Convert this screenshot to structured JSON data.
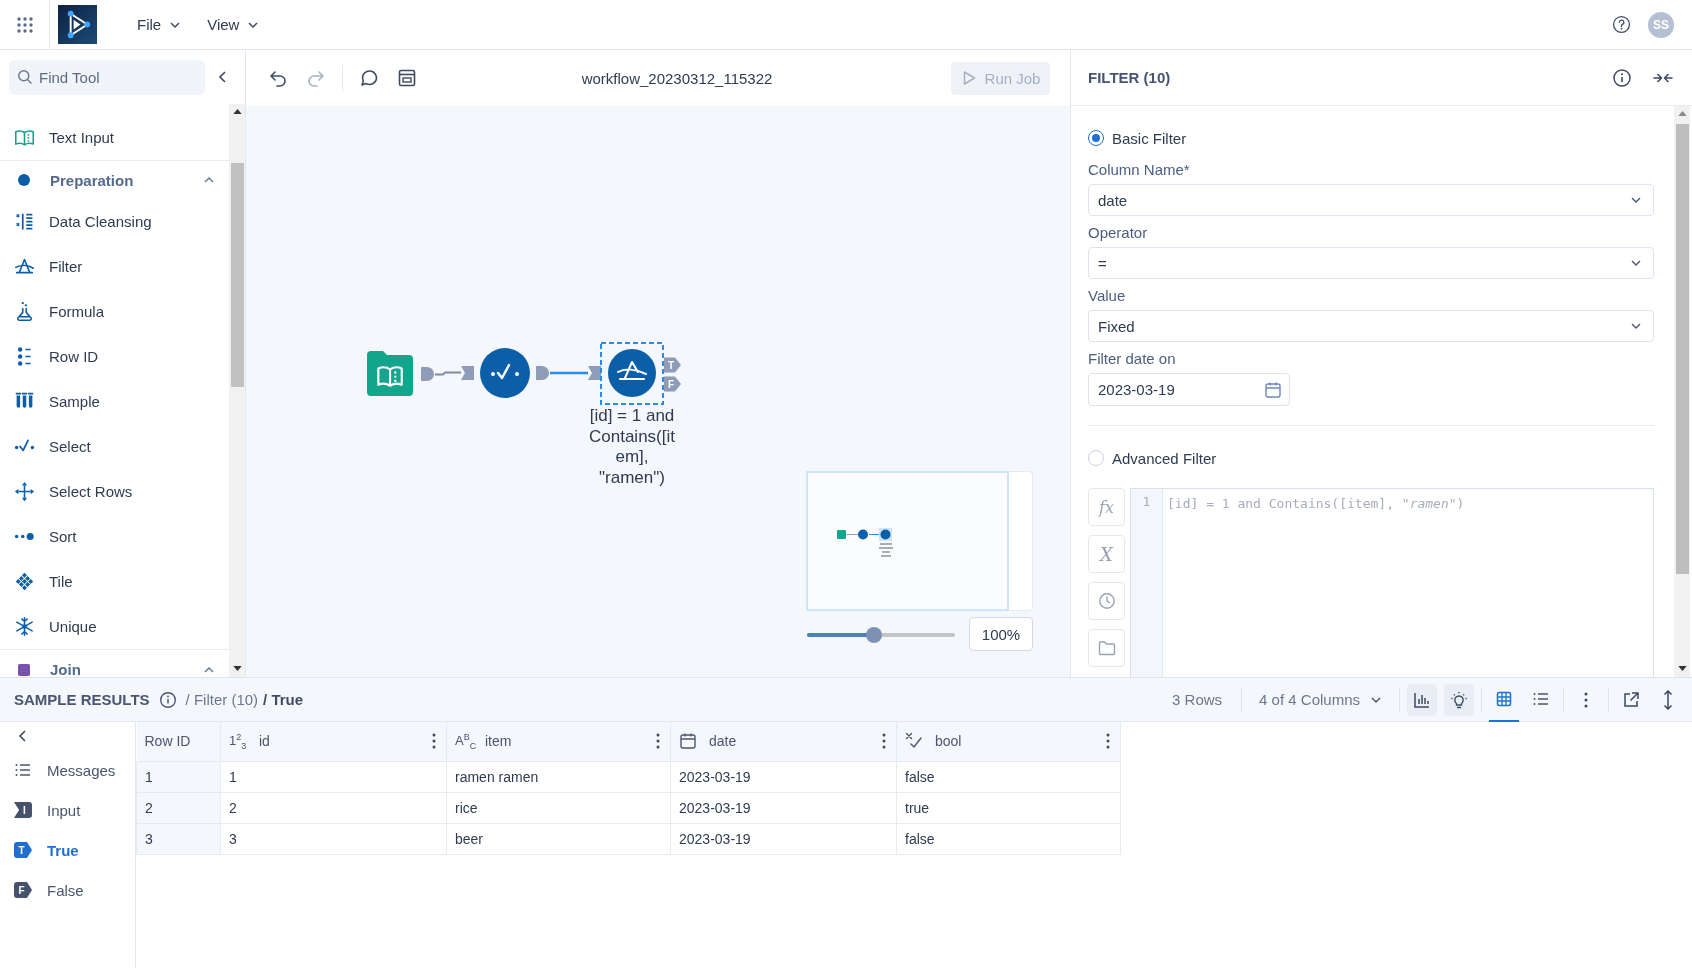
{
  "app_bar": {
    "menus": [
      {
        "label": "File"
      },
      {
        "label": "View"
      }
    ],
    "avatar": "SS"
  },
  "palette": {
    "search": {
      "placeholder": "Find Tool"
    },
    "items": [
      {
        "kind": "tool",
        "label": "Text Input",
        "color": "#13a38b"
      },
      {
        "kind": "category",
        "label": "Preparation",
        "color": "#0c5ea8",
        "expanded": true,
        "children": [
          {
            "label": "Data Cleansing"
          },
          {
            "label": "Filter"
          },
          {
            "label": "Formula"
          },
          {
            "label": "Row ID"
          },
          {
            "label": "Sample"
          },
          {
            "label": "Select"
          },
          {
            "label": "Select Rows"
          },
          {
            "label": "Sort"
          },
          {
            "label": "Tile"
          },
          {
            "label": "Unique"
          }
        ]
      },
      {
        "kind": "category",
        "label": "Join",
        "color": "#7b52ab",
        "expanded": true
      }
    ]
  },
  "canvas": {
    "tools": [
      {
        "kind": "undo",
        "disabled": false
      },
      {
        "kind": "redo",
        "disabled": true
      },
      {
        "kind": "comment",
        "disabled": false
      },
      {
        "kind": "layout",
        "disabled": false
      }
    ],
    "title": "workflow_20230312_115322",
    "run_button": {
      "label": "Run Job",
      "disabled": true
    },
    "nodes": [
      {
        "kind": "text_input",
        "selected": false
      },
      {
        "kind": "select",
        "selected": false
      },
      {
        "kind": "filter",
        "selected": true,
        "annotation": "[id] = 1 and Contains([item], \"ramen\")",
        "outputs": [
          "T",
          "F"
        ]
      }
    ],
    "connections": [
      {
        "active": false
      },
      {
        "active": true
      }
    ],
    "zoom": {
      "level": 0.45,
      "reading": "100%"
    }
  },
  "config_panel": {
    "title": "FILTER (10)",
    "basic_filter": {
      "label": "Basic Filter",
      "selected": true,
      "fields": [
        {
          "kind": "select",
          "label": "Column Name*",
          "value": "date"
        },
        {
          "kind": "select",
          "label": "Operator",
          "value": "="
        },
        {
          "kind": "select",
          "label": "Value",
          "value": "Fixed"
        },
        {
          "kind": "date",
          "label": "Filter date on",
          "value": "2023-03-19"
        }
      ]
    },
    "advanced_filter": {
      "label": "Advanced Filter",
      "selected": false,
      "tools": [
        {
          "kind": "function",
          "symbol": "fx"
        },
        {
          "kind": "variable",
          "symbol": "X"
        },
        {
          "kind": "time"
        },
        {
          "kind": "folder"
        }
      ],
      "editor": {
        "line_number": "1",
        "expression": "[id] = 1 and Contains([item], *\"ramen\"*)"
      }
    }
  },
  "results": {
    "title": "SAMPLE RESULTS",
    "breadcrumb": [
      {
        "separator": "/",
        "label": "Filter (10)"
      },
      {
        "separator": "/",
        "label": "True"
      }
    ],
    "row_count": "3 Rows",
    "columns_menu": "4 of 4 Columns",
    "views": [
      {
        "kind": "grid",
        "selected": true
      },
      {
        "kind": "list",
        "selected": false
      }
    ],
    "nav": [
      {
        "kind": "messages",
        "label": "Messages",
        "selected": false
      },
      {
        "kind": "input_anchor",
        "badge": "I",
        "label": "Input",
        "selected": false
      },
      {
        "kind": "output_anchor",
        "badge": "T",
        "label": "True",
        "selected": true
      },
      {
        "kind": "output_anchor",
        "badge": "F",
        "label": "False",
        "selected": false
      }
    ],
    "table": {
      "columns": [
        {
          "kind": "row_id",
          "name": "Row ID"
        },
        {
          "kind": "number",
          "symbol": "1$^{2}$$_{3}$",
          "name": "id"
        },
        {
          "kind": "string",
          "symbol": "A$^{B}$$_{C}$",
          "name": "item"
        },
        {
          "kind": "date",
          "name": "date"
        },
        {
          "kind": "boolean",
          "name": "bool"
        }
      ],
      "rows": [
        [
          "1",
          "1",
          "ramen ramen",
          "2023-03-19",
          "false"
        ],
        [
          "2",
          "2",
          "rice",
          "2023-03-19",
          "true"
        ],
        [
          "3",
          "3",
          "beer",
          "2023-03-19",
          "false"
        ]
      ]
    }
  }
}
